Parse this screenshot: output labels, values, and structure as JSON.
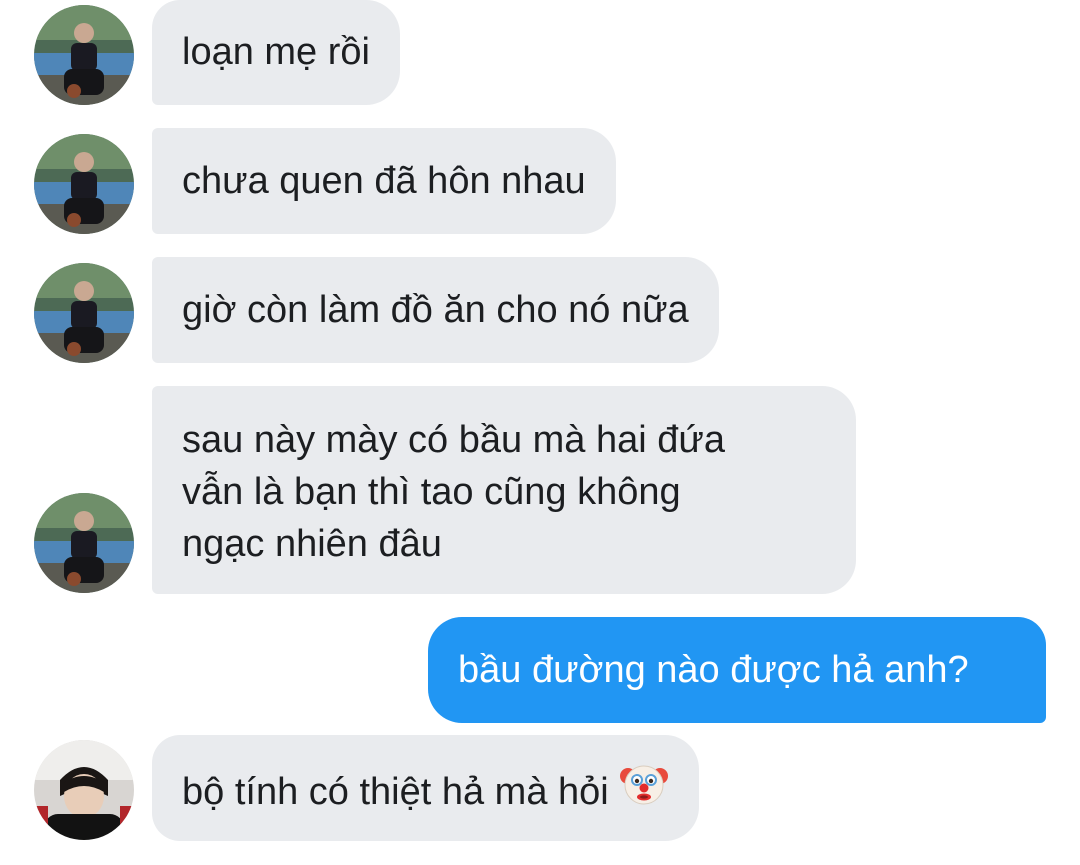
{
  "messages": [
    {
      "sender": "other",
      "lines": [
        "loạn mẹ rồi"
      ]
    },
    {
      "sender": "other",
      "lines": [
        "chưa quen đã hôn nhau"
      ]
    },
    {
      "sender": "other",
      "lines": [
        "giờ còn làm đồ ăn cho nó nữa"
      ]
    },
    {
      "sender": "other",
      "lines": [
        "sau này mày có bầu mà hai đứa",
        "vẫn là bạn thì tao cũng không",
        "ngạc nhiên đâu"
      ]
    },
    {
      "sender": "me",
      "lines": [
        "bầu đường nào được hả anh?"
      ]
    },
    {
      "sender": "other2",
      "lines": [
        "bộ tính có thiệt hả mà hỏi"
      ],
      "emoji": "clown-face"
    }
  ],
  "colors": {
    "incoming_bubble": "#e9ebee",
    "outgoing_bubble": "#2196f3",
    "incoming_text": "#1c1e21",
    "outgoing_text": "#ffffff"
  }
}
